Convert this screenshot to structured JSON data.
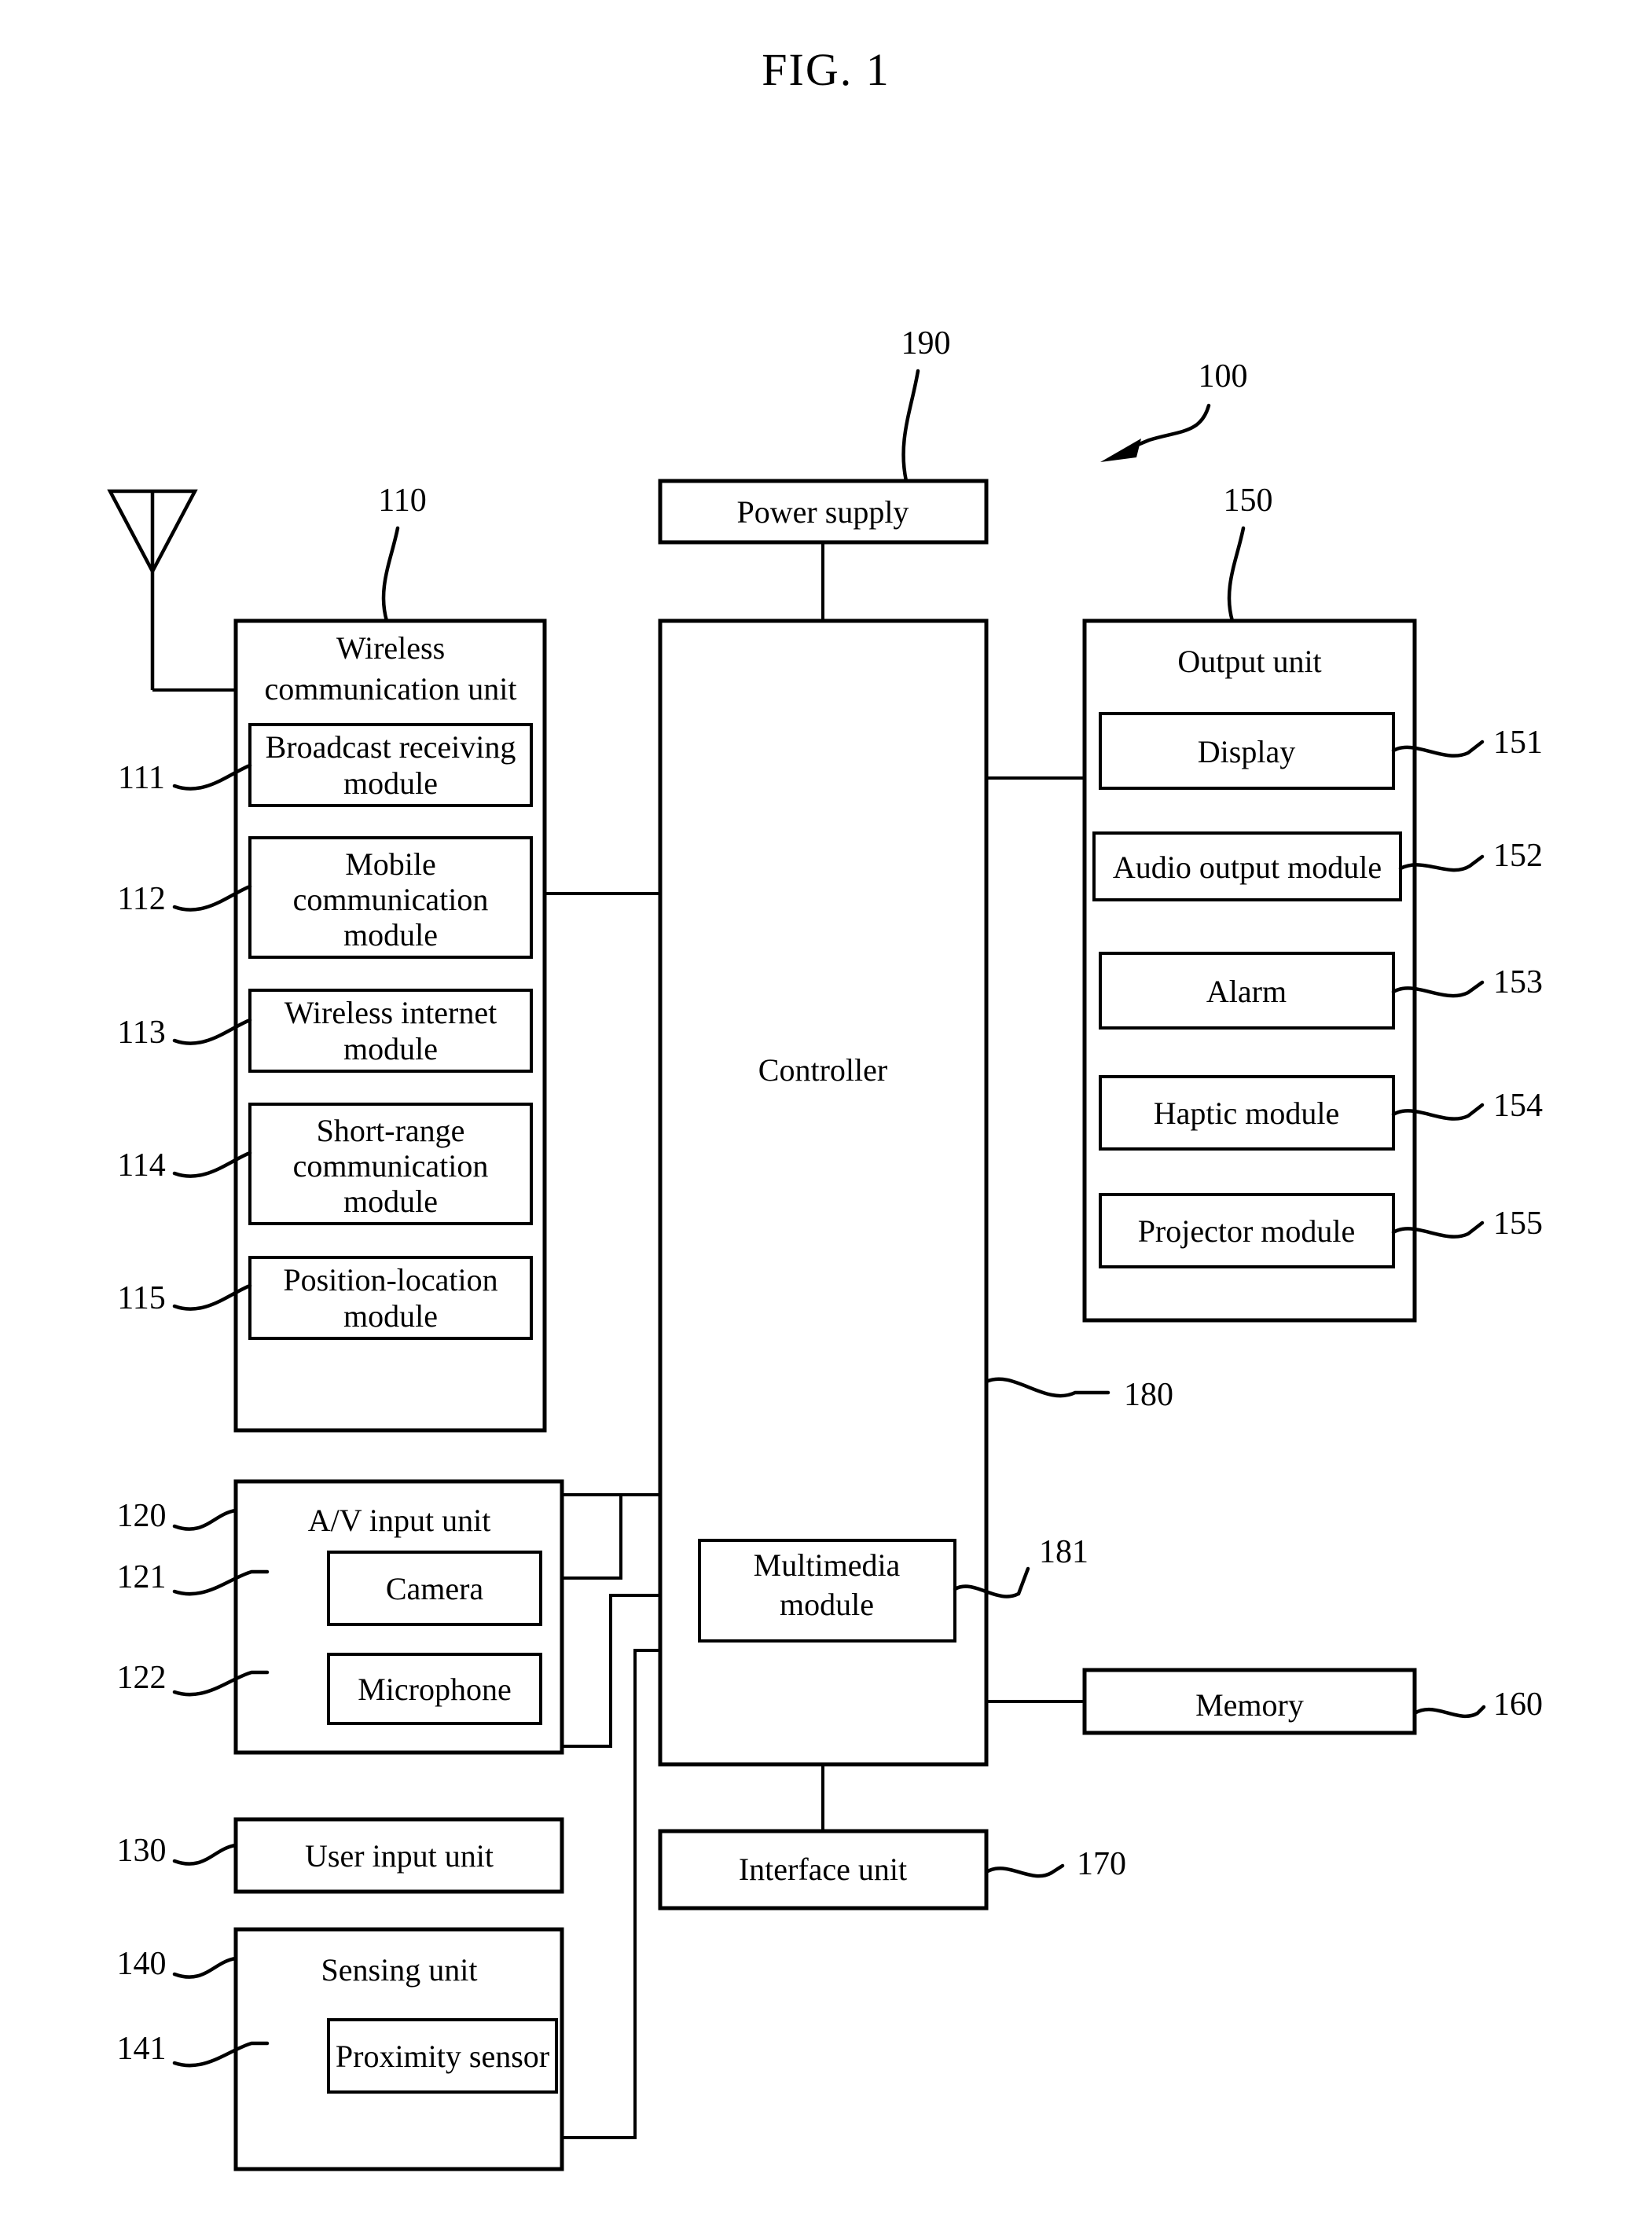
{
  "figure": {
    "title": "FIG. 1",
    "device_ref": "100"
  },
  "blocks": {
    "power_supply": {
      "label": "Power supply",
      "ref": "190"
    },
    "controller": {
      "label": "Controller",
      "ref": "180"
    },
    "multimedia": {
      "label_line1": "Multimedia",
      "label_line2": "module",
      "ref": "181"
    },
    "memory": {
      "label": "Memory",
      "ref": "160"
    },
    "interface": {
      "label": "Interface unit",
      "ref": "170"
    },
    "user_input": {
      "label": "User input unit",
      "ref": "130"
    }
  },
  "wireless_unit": {
    "title_line1": "Wireless",
    "title_line2": "communication unit",
    "ref": "110",
    "modules": [
      {
        "ref": "111",
        "lines": [
          "Broadcast receiving",
          "module"
        ]
      },
      {
        "ref": "112",
        "lines": [
          "Mobile",
          "communication",
          "module"
        ]
      },
      {
        "ref": "113",
        "lines": [
          "Wireless internet",
          "module"
        ]
      },
      {
        "ref": "114",
        "lines": [
          "Short-range",
          "communication",
          "module"
        ]
      },
      {
        "ref": "115",
        "lines": [
          "Position-location",
          "module"
        ]
      }
    ]
  },
  "output_unit": {
    "title": "Output unit",
    "ref": "150",
    "modules": [
      {
        "ref": "151",
        "label": "Display"
      },
      {
        "ref": "152",
        "label": "Audio output module"
      },
      {
        "ref": "153",
        "label": "Alarm"
      },
      {
        "ref": "154",
        "label": "Haptic module"
      },
      {
        "ref": "155",
        "label": "Projector module"
      }
    ]
  },
  "av_input_unit": {
    "title": "A/V input unit",
    "ref": "120",
    "modules": [
      {
        "ref": "121",
        "label": "Camera"
      },
      {
        "ref": "122",
        "label": "Microphone"
      }
    ]
  },
  "sensing_unit": {
    "title": "Sensing unit",
    "ref": "140",
    "modules": [
      {
        "ref": "141",
        "label": "Proximity sensor"
      }
    ]
  },
  "icons": {
    "antenna": "antenna-icon",
    "pointer": "pointer-arrow-icon"
  },
  "colors": {
    "ink": "#000000",
    "paper": "#ffffff"
  }
}
